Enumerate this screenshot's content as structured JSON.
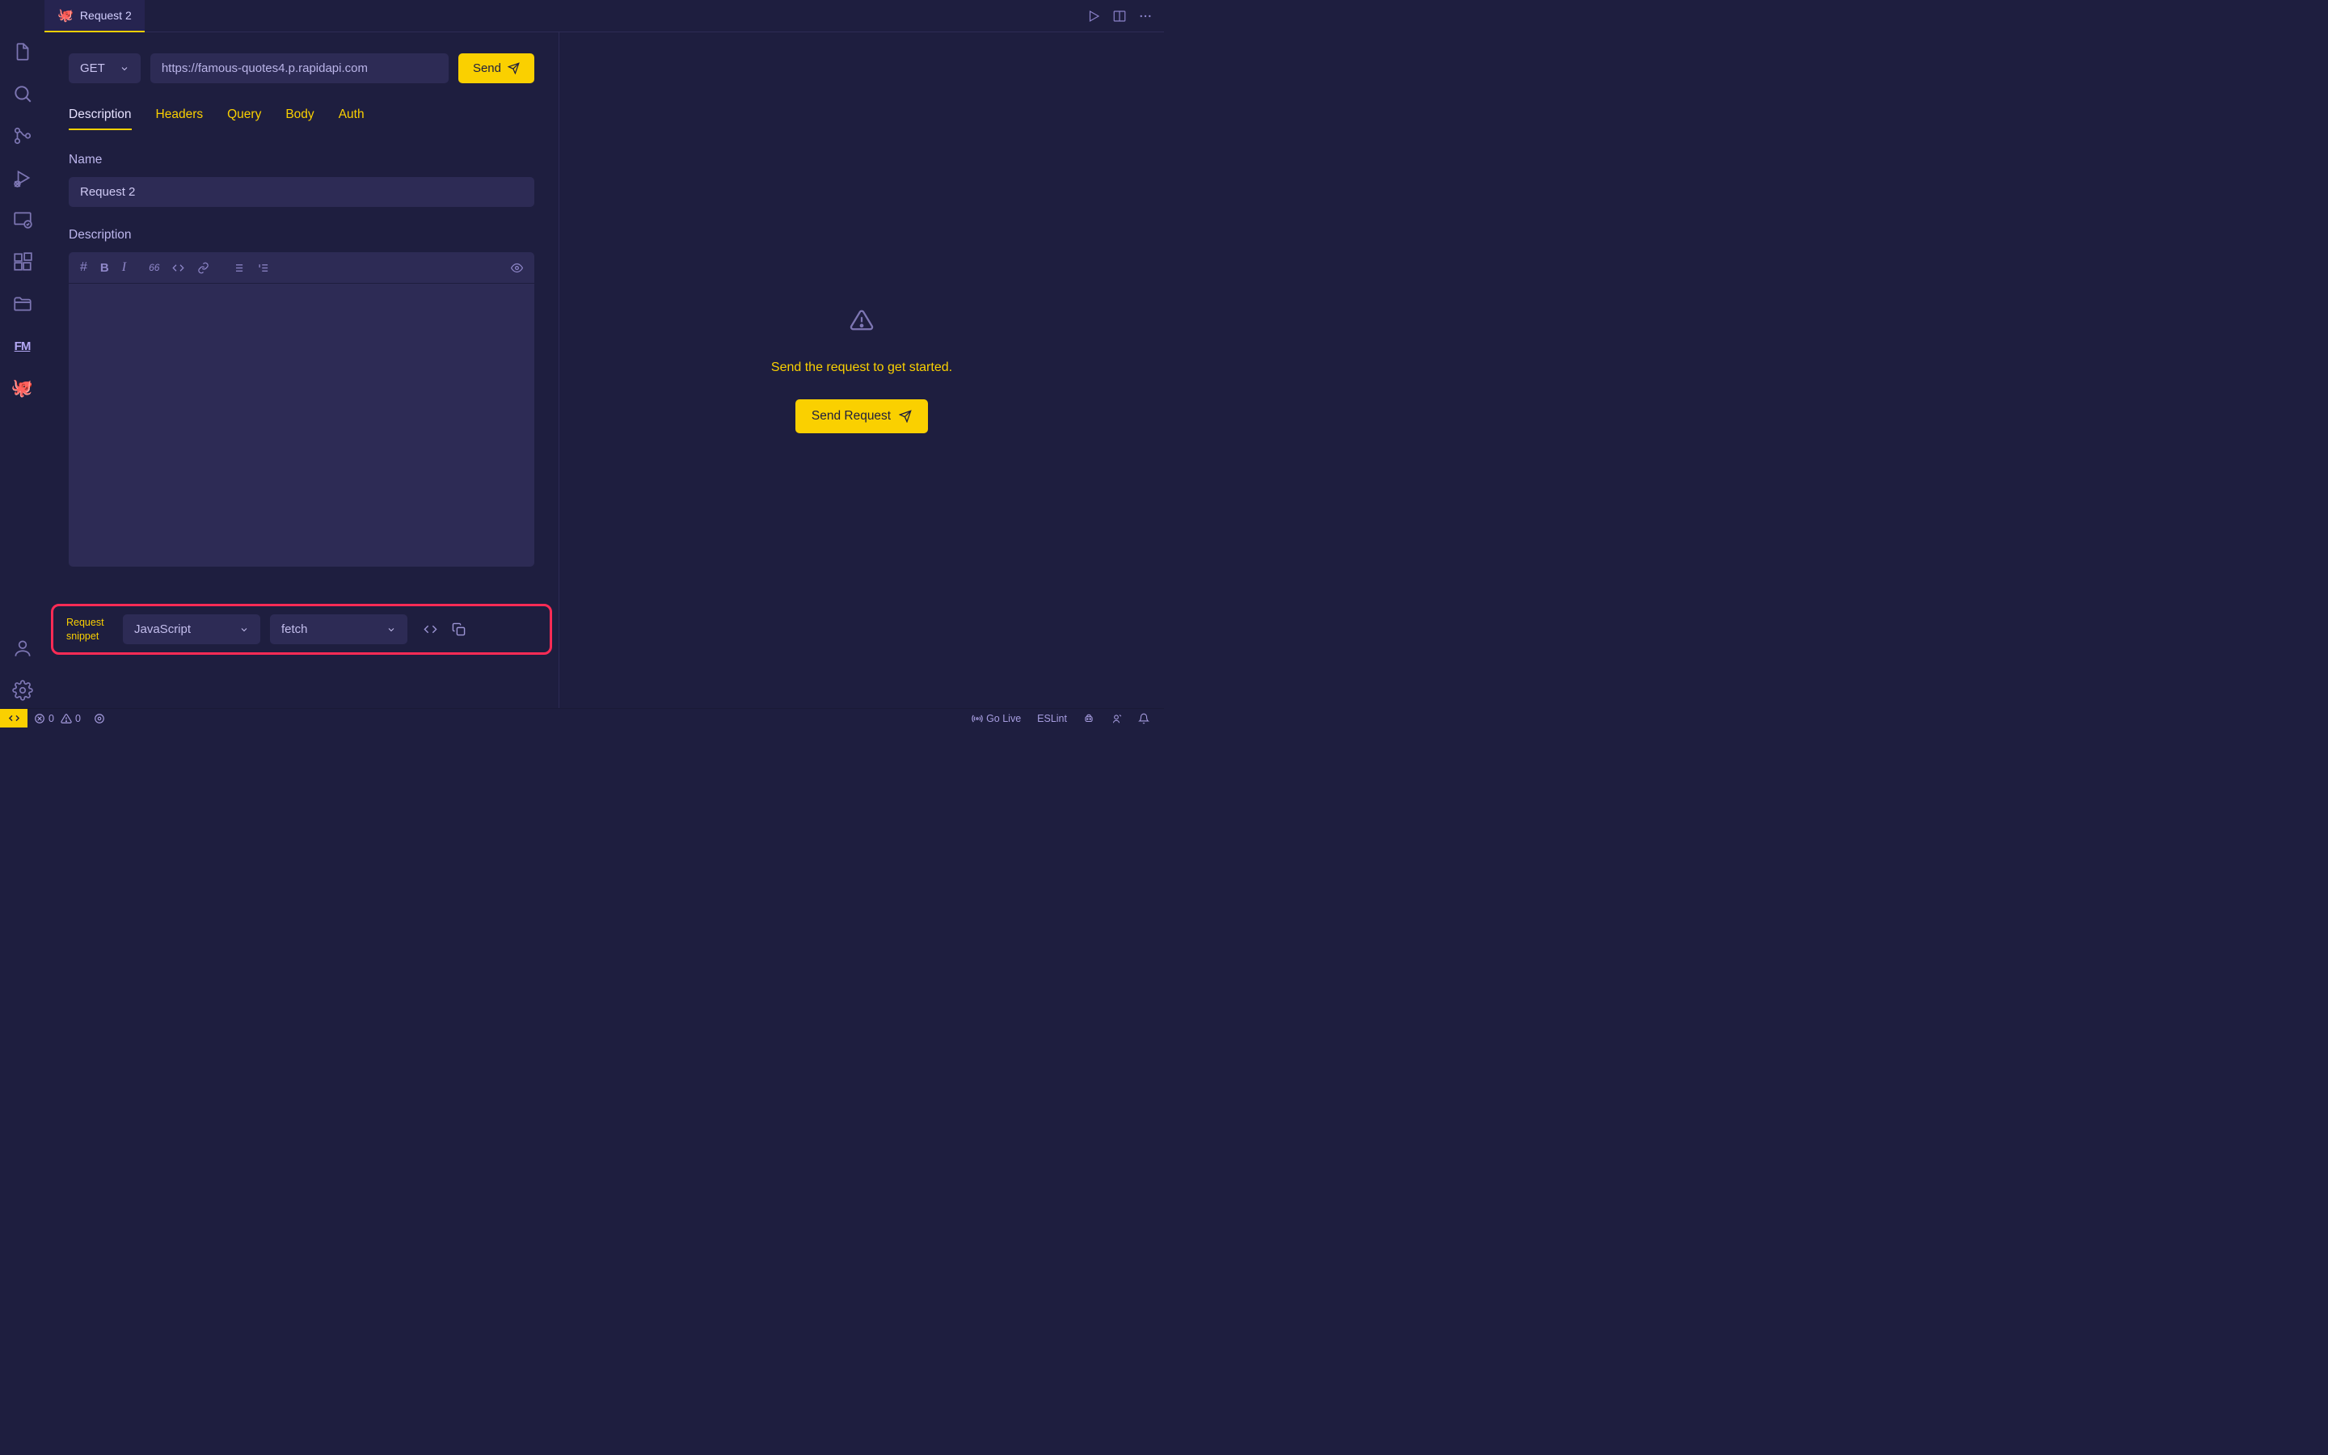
{
  "tab": {
    "title": "Request 2",
    "icon": "🐙"
  },
  "request": {
    "method": "GET",
    "url": "https://famous-quotes4.p.rapidapi.com",
    "send_label": "Send"
  },
  "req_tabs": {
    "description": "Description",
    "headers": "Headers",
    "query": "Query",
    "body": "Body",
    "auth": "Auth"
  },
  "fields": {
    "name_label": "Name",
    "name_value": "Request 2",
    "description_label": "Description"
  },
  "snippet": {
    "label": "Request snippet",
    "language": "JavaScript",
    "library": "fetch"
  },
  "empty_state": {
    "message": "Send the request to get started.",
    "button": "Send Request"
  },
  "statusbar": {
    "errors": "0",
    "warnings": "0",
    "golive": "Go Live",
    "eslint": "ESLint"
  }
}
